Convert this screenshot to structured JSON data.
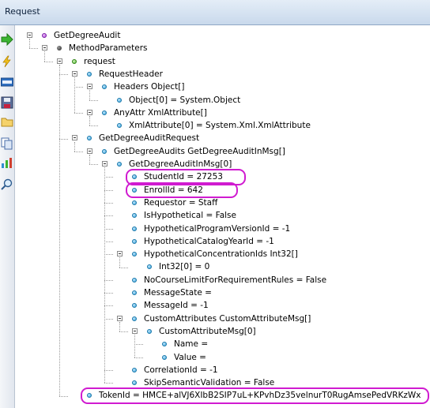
{
  "window": {
    "title": "Request"
  },
  "toolbar": {
    "icons": [
      "play-icon",
      "lightning-icon",
      "xml-icon",
      "save-icon",
      "folder-icon",
      "copy-icon",
      "chart-icon",
      "inspect-icon"
    ]
  },
  "tree": {
    "nodes": [
      {
        "label": "GetDegreeAudit",
        "depth": 0,
        "icon": "purple",
        "expandable": true
      },
      {
        "label": "MethodParameters",
        "depth": 1,
        "icon": "dark",
        "expandable": true
      },
      {
        "label": "request",
        "depth": 2,
        "icon": "green",
        "expandable": true
      },
      {
        "label": "RequestHeader",
        "depth": 3,
        "icon": "blue",
        "expandable": true
      },
      {
        "label": "Headers Object[]",
        "depth": 4,
        "icon": "blue",
        "expandable": true
      },
      {
        "label": "Object[0] = System.Object",
        "depth": 5,
        "icon": "blue",
        "expandable": false
      },
      {
        "label": "AnyAttr XmlAttribute[]",
        "depth": 4,
        "icon": "blue",
        "expandable": true
      },
      {
        "label": "XmlAttribute[0] = System.Xml.XmlAttribute",
        "depth": 5,
        "icon": "blue",
        "expandable": false
      },
      {
        "label": "GetDegreeAuditRequest",
        "depth": 3,
        "icon": "blue",
        "expandable": true
      },
      {
        "label": "GetDegreeAudits GetDegreeAuditInMsg[]",
        "depth": 4,
        "icon": "blue",
        "expandable": true
      },
      {
        "label": "GetDegreeAuditInMsg[0]",
        "depth": 5,
        "icon": "blue",
        "expandable": true
      },
      {
        "label": "StudentId = 27253",
        "depth": 6,
        "icon": "blue",
        "expandable": false,
        "highlighted": true
      },
      {
        "label": "EnrollId = 642",
        "depth": 6,
        "icon": "blue",
        "expandable": false,
        "highlighted": true
      },
      {
        "label": "Requestor = Staff",
        "depth": 6,
        "icon": "blue",
        "expandable": false
      },
      {
        "label": "IsHypothetical = False",
        "depth": 6,
        "icon": "blue",
        "expandable": false
      },
      {
        "label": "HypotheticalProgramVersionId = -1",
        "depth": 6,
        "icon": "blue",
        "expandable": false
      },
      {
        "label": "HypotheticalCatalogYearId = -1",
        "depth": 6,
        "icon": "blue",
        "expandable": false
      },
      {
        "label": "HypotheticalConcentrationIds Int32[]",
        "depth": 6,
        "icon": "blue",
        "expandable": true
      },
      {
        "label": "Int32[0] = 0",
        "depth": 7,
        "icon": "blue",
        "expandable": false
      },
      {
        "label": "NoCourseLimitForRequirementRules = False",
        "depth": 6,
        "icon": "blue",
        "expandable": false
      },
      {
        "label": "MessageState =",
        "depth": 6,
        "icon": "blue",
        "expandable": false
      },
      {
        "label": "MessageId = -1",
        "depth": 6,
        "icon": "blue",
        "expandable": false
      },
      {
        "label": "CustomAttributes CustomAttributeMsg[]",
        "depth": 6,
        "icon": "blue",
        "expandable": true
      },
      {
        "label": "CustomAttributeMsg[0]",
        "depth": 7,
        "icon": "blue",
        "expandable": true
      },
      {
        "label": "Name =",
        "depth": 8,
        "icon": "blue",
        "expandable": false
      },
      {
        "label": "Value =",
        "depth": 8,
        "icon": "blue",
        "expandable": false
      },
      {
        "label": "CorrelationId = -1",
        "depth": 6,
        "icon": "blue",
        "expandable": false
      },
      {
        "label": "SkipSemanticValidation = False",
        "depth": 6,
        "icon": "blue",
        "expandable": false
      },
      {
        "label": "TokenId = HMCE+alVJ6XIbB2SIP7uL+KPvhDz35velnurT0RugAmsePedVRKzWx",
        "depth": 3,
        "icon": "blue",
        "expandable": false,
        "highlighted": true
      }
    ]
  },
  "colors": {
    "highlight": "#d01bd0",
    "node_blue": "#2d9bd6",
    "node_purple": "#a83bd6",
    "node_green": "#4fb52a"
  }
}
